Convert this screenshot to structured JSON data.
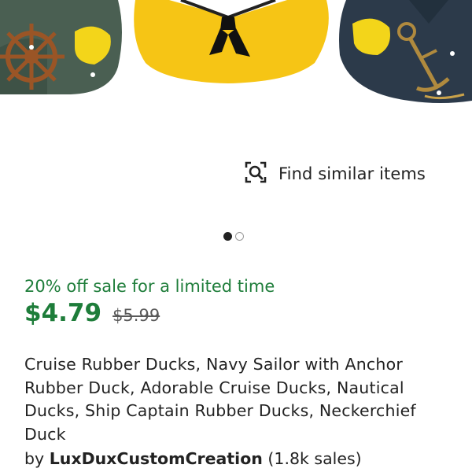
{
  "gallery": {
    "images": [
      "duck-ship-wheel",
      "duck-sailor",
      "duck-anchor"
    ],
    "active_index": 0,
    "total": 2
  },
  "find_similar": {
    "label": "Find similar items",
    "icon": "visual-search-icon"
  },
  "listing": {
    "sale_text": "20% off sale for a limited time",
    "price": "$4.79",
    "original_price": "$5.99",
    "title": "Cruise Rubber Ducks, Navy Sailor with Anchor Rubber Duck, Adorable Cruise Ducks, Nautical Ducks, Ship Captain Rubber Ducks, Neckerchief Duck",
    "seller_prefix": "by",
    "shop_name": "LuxDuxCustomCreation",
    "sales_count": "(1.8k sales)"
  },
  "colors": {
    "sale_green": "#1e7d3a",
    "text": "#222222",
    "muted": "#595959"
  }
}
